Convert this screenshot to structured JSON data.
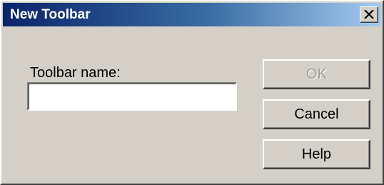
{
  "dialog": {
    "title": "New Toolbar",
    "close_icon": "close-x-icon",
    "toolbar_name_label": "Toolbar name:",
    "toolbar_name_value": "",
    "buttons": {
      "ok": "OK",
      "ok_enabled": false,
      "cancel": "Cancel",
      "help": "Help"
    }
  },
  "colors": {
    "face": "#d4d0c8",
    "title_gradient_start": "#0a246a",
    "title_gradient_end": "#a6caf0",
    "disabled_text": "#a19e98"
  }
}
